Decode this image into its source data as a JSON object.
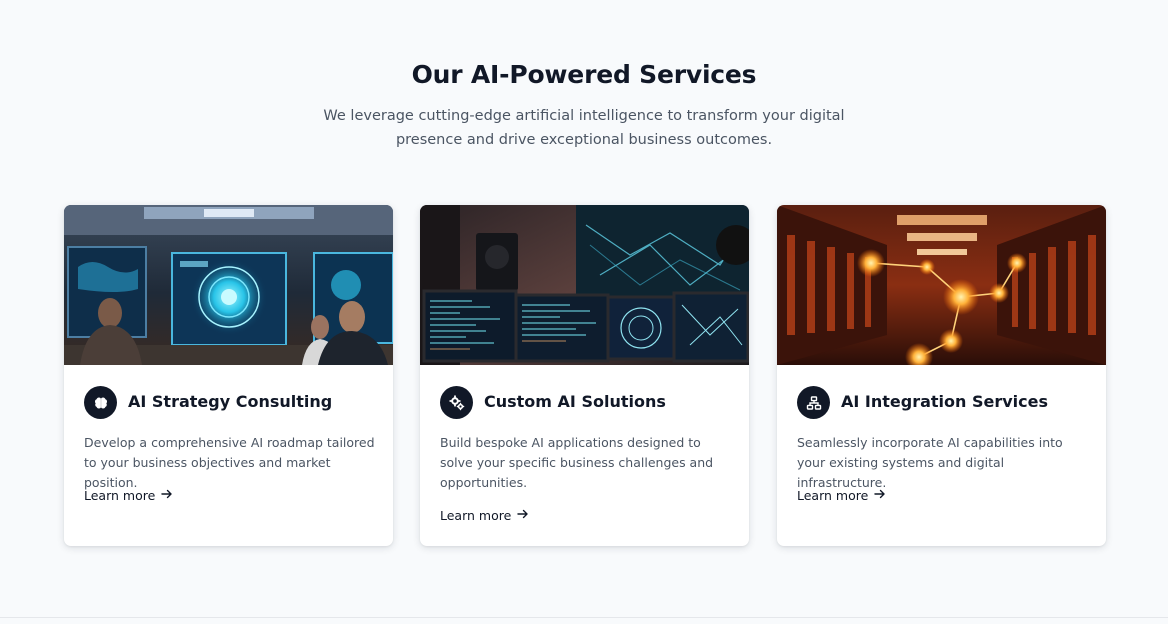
{
  "section": {
    "title": "Our AI-Powered Services",
    "subtitle": "We leverage cutting-edge artificial intelligence to transform your digital presence and drive exceptional business outcomes."
  },
  "cards": [
    {
      "title": "AI Strategy Consulting",
      "description": "Develop a comprehensive AI roadmap tailored to your business objectives and market position.",
      "link": "Learn more",
      "icon": "brain-icon",
      "image": "ai-strategy-room-image"
    },
    {
      "title": "Custom AI Solutions",
      "description": "Build bespoke AI applications designed to solve your specific business challenges and opportunities.",
      "link": "Learn more",
      "icon": "cogs-icon",
      "image": "coding-monitors-image"
    },
    {
      "title": "AI Integration Services",
      "description": "Seamlessly incorporate AI capabilities into your existing systems and digital infrastructure.",
      "link": "Learn more",
      "icon": "network-icon",
      "image": "server-room-image"
    }
  ],
  "colors": {
    "background": "#f8fafc",
    "heading": "#111827",
    "body_text": "#4b5563",
    "icon_bg": "#111827",
    "card_bg": "#ffffff"
  }
}
